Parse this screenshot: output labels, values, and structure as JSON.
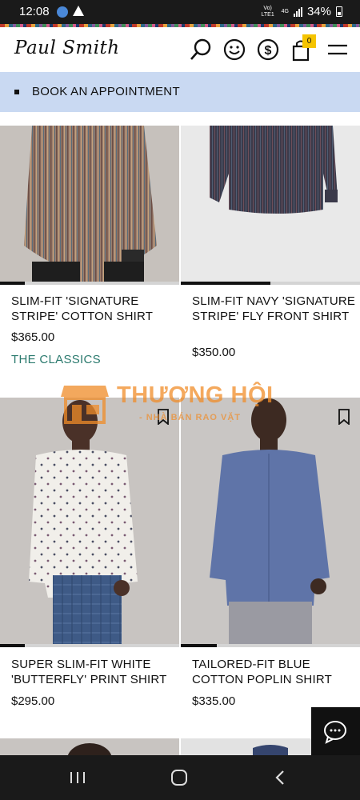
{
  "status_bar": {
    "time": "12:08",
    "network": "4G",
    "carrier_line": "Vo) LTE1",
    "battery": "34%"
  },
  "header": {
    "brand": "Paul Smith",
    "cart_count": "0"
  },
  "appointment": {
    "label": "BOOK AN APPOINTMENT"
  },
  "products": [
    {
      "name": "SLIM-FIT 'SIGNATURE STRIPE' COTTON SHIRT",
      "price": "$365.00",
      "tag": "THE CLASSICS",
      "gallery_progress": 0.14
    },
    {
      "name": "SLIM-FIT NAVY 'SIGNATURE STRIPE' FLY FRONT SHIRT",
      "price": "$350.00",
      "tag": "",
      "gallery_progress": 0.5
    },
    {
      "name": "SUPER SLIM-FIT WHITE 'BUTTERFLY' PRINT SHIRT",
      "price": "$295.00",
      "tag": "",
      "gallery_progress": 0.14
    },
    {
      "name": "TAILORED-FIT BLUE COTTON POPLIN SHIRT",
      "price": "$335.00",
      "tag": "",
      "gallery_progress": 0.2
    }
  ],
  "watermark": {
    "title": "THƯƠNG HỘI",
    "subtitle": "- NHÀ BÁN RAO VẶT"
  },
  "colors": {
    "appointment_bg": "#c9d9f2",
    "tag_color": "#2b7a6e",
    "cart_badge": "#f5c400",
    "watermark": "#f08c28"
  },
  "icons": [
    "search-icon",
    "account-icon",
    "currency-icon",
    "cart-icon",
    "menu-icon",
    "bookmark-icon",
    "chat-icon",
    "recent-apps-icon",
    "home-icon",
    "back-icon"
  ]
}
